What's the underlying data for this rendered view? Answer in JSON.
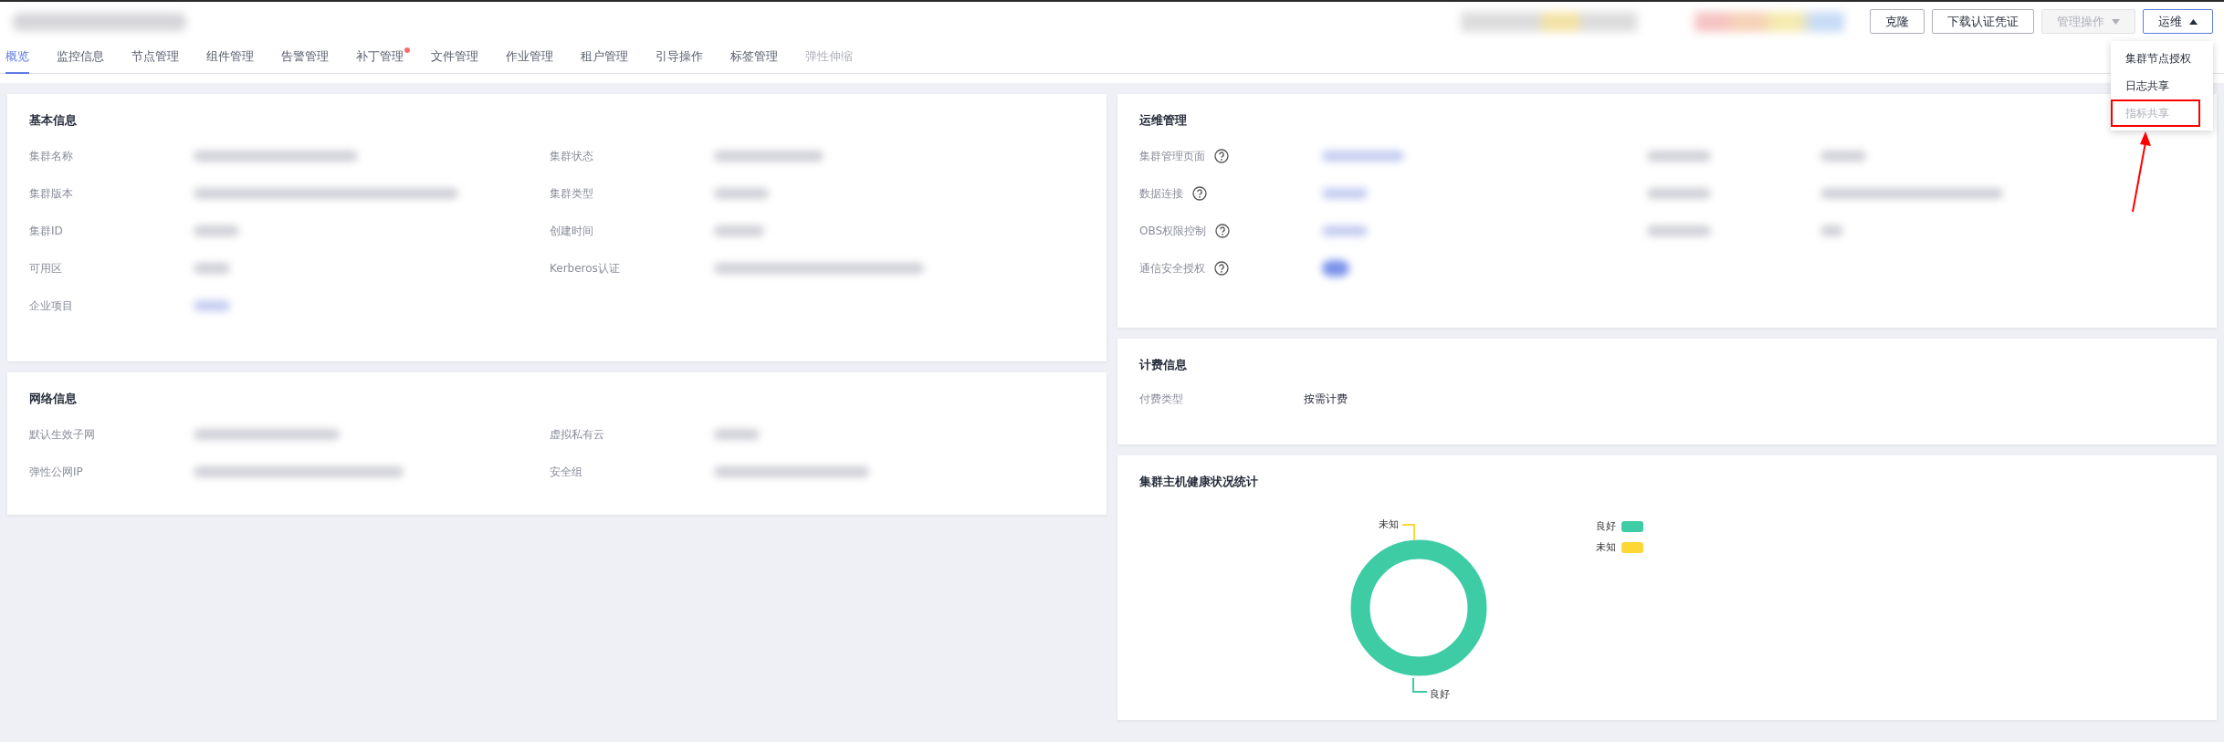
{
  "header": {
    "buttons": [
      {
        "label": "克隆",
        "kind": "plain",
        "disabled": false
      },
      {
        "label": "下载认证凭证",
        "kind": "plain",
        "disabled": false
      },
      {
        "label": "管理操作",
        "kind": "dropdown",
        "disabled": true,
        "expanded": false
      },
      {
        "label": "运维",
        "kind": "dropdown",
        "disabled": false,
        "expanded": true
      }
    ]
  },
  "dropdown_menu": {
    "items": [
      {
        "label": "集群节点授权",
        "disabled": false,
        "highlighted": false
      },
      {
        "label": "日志共享",
        "disabled": false,
        "highlighted": false
      },
      {
        "label": "指标共享",
        "disabled": true,
        "highlighted": true
      }
    ]
  },
  "tabs": [
    {
      "label": "概览",
      "selected": true,
      "disabled": false,
      "badge": false
    },
    {
      "label": "监控信息",
      "selected": false,
      "disabled": false,
      "badge": false
    },
    {
      "label": "节点管理",
      "selected": false,
      "disabled": false,
      "badge": false
    },
    {
      "label": "组件管理",
      "selected": false,
      "disabled": false,
      "badge": false
    },
    {
      "label": "告警管理",
      "selected": false,
      "disabled": false,
      "badge": false
    },
    {
      "label": "补丁管理",
      "selected": false,
      "disabled": false,
      "badge": true
    },
    {
      "label": "文件管理",
      "selected": false,
      "disabled": false,
      "badge": false
    },
    {
      "label": "作业管理",
      "selected": false,
      "disabled": false,
      "badge": false
    },
    {
      "label": "租户管理",
      "selected": false,
      "disabled": false,
      "badge": false
    },
    {
      "label": "引导操作",
      "selected": false,
      "disabled": false,
      "badge": false
    },
    {
      "label": "标签管理",
      "selected": false,
      "disabled": false,
      "badge": false
    },
    {
      "label": "弹性伸缩",
      "selected": false,
      "disabled": true,
      "badge": false
    }
  ],
  "basic_info": {
    "title": "基本信息",
    "fields": [
      {
        "label": "集群名称"
      },
      {
        "label": "集群状态"
      },
      {
        "label": "集群版本"
      },
      {
        "label": "集群类型"
      },
      {
        "label": "集群ID"
      },
      {
        "label": "创建时间"
      },
      {
        "label": "可用区"
      },
      {
        "label": "Kerberos认证"
      },
      {
        "label": "企业项目"
      }
    ]
  },
  "network_info": {
    "title": "网络信息",
    "fields": [
      {
        "label": "默认生效子网"
      },
      {
        "label": "虚拟私有云"
      },
      {
        "label": "弹性公网IP"
      },
      {
        "label": "安全组"
      }
    ]
  },
  "ops_management": {
    "title": "运维管理",
    "rows": [
      {
        "label": "集群管理页面"
      },
      {
        "label": "数据连接"
      },
      {
        "label": "OBS权限控制"
      },
      {
        "label": "通信安全授权"
      }
    ]
  },
  "billing_info": {
    "title": "计费信息",
    "fields": [
      {
        "label": "付费类型",
        "value": "按需计费"
      }
    ]
  },
  "health_stats": {
    "title": "集群主机健康状况统计",
    "slice_labels": [
      {
        "label": "未知",
        "color": "#fdd835"
      },
      {
        "label": "良好",
        "color": "#3ecca5"
      }
    ],
    "legend": [
      {
        "label": "良好",
        "color": "#3ecca5"
      },
      {
        "label": "未知",
        "color": "#fdd835"
      }
    ]
  }
}
